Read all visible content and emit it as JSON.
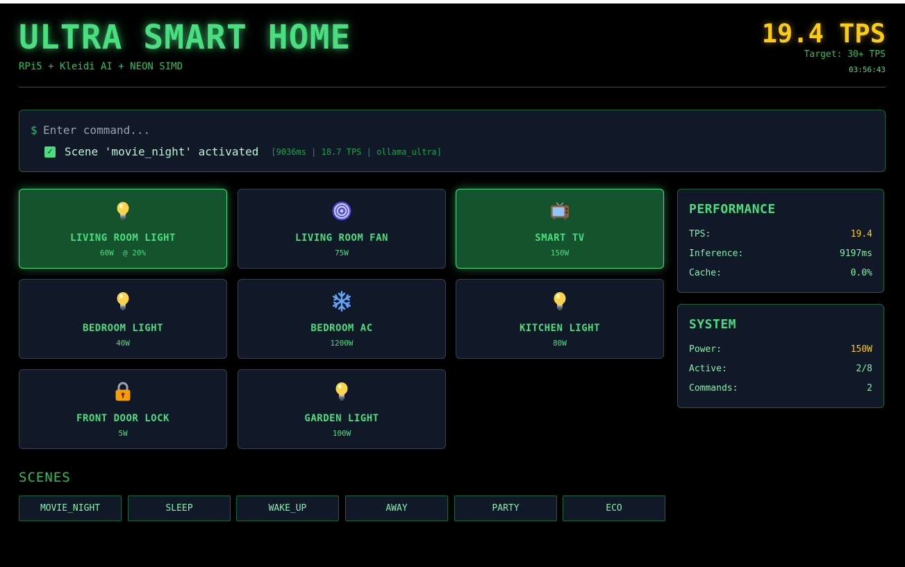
{
  "header": {
    "title": "ULTRA SMART HOME",
    "subtitle": "RPi5 + Kleidi AI + NEON SIMD",
    "tps": "19.4 TPS",
    "target": "Target: 30+ TPS",
    "clock": "03:56:43"
  },
  "command": {
    "prompt": "$",
    "placeholder": "Enter command...",
    "result_text": "Scene 'movie_night' activated",
    "result_meta": "[9036ms | 18.7 TPS | ollama_ultra]"
  },
  "devices": [
    {
      "name": "LIVING ROOM LIGHT",
      "power": "60W  @ 20%",
      "icon": "lightbulb-icon",
      "active": true
    },
    {
      "name": "LIVING ROOM FAN",
      "power": "75W",
      "icon": "fan-icon",
      "active": false
    },
    {
      "name": "SMART TV",
      "power": "150W",
      "icon": "tv-icon",
      "active": true
    },
    {
      "name": "BEDROOM LIGHT",
      "power": "40W",
      "icon": "lightbulb-icon",
      "active": false
    },
    {
      "name": "BEDROOM AC",
      "power": "1200W",
      "icon": "snowflake-icon",
      "active": false
    },
    {
      "name": "KITCHEN LIGHT",
      "power": "80W",
      "icon": "lightbulb-icon",
      "active": false
    },
    {
      "name": "FRONT DOOR LOCK",
      "power": "5W",
      "icon": "lock-icon",
      "active": false
    },
    {
      "name": "GARDEN LIGHT",
      "power": "100W",
      "icon": "lightbulb-icon",
      "active": false
    }
  ],
  "performance": {
    "title": "PERFORMANCE",
    "tps_label": "TPS:",
    "tps_value": "19.4",
    "inference_label": "Inference:",
    "inference_value": "9197ms",
    "cache_label": "Cache:",
    "cache_value": "0.0%"
  },
  "system": {
    "title": "SYSTEM",
    "power_label": "Power:",
    "power_value": "150W",
    "active_label": "Active:",
    "active_value": "2/8",
    "commands_label": "Commands:",
    "commands_value": "2"
  },
  "scenes": {
    "title": "SCENES",
    "buttons": [
      "MOVIE_NIGHT",
      "SLEEP",
      "WAKE_UP",
      "AWAY",
      "PARTY",
      "ECO"
    ]
  },
  "colors": {
    "background": "#000000",
    "accent_green": "#4ade80",
    "accent_yellow": "#facc15",
    "card_background": "#111827",
    "active_card_background": "#14532d"
  }
}
